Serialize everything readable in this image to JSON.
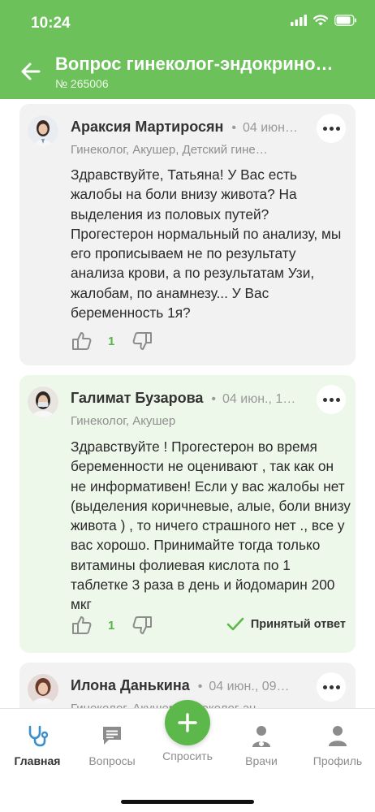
{
  "status_bar": {
    "time": "10:24",
    "signal_icon": "signal-icon",
    "wifi_icon": "wifi-icon",
    "battery_icon": "battery-icon"
  },
  "header": {
    "title": "Вопрос гинеколог-эндокрино…",
    "subtitle": "№ 265006",
    "back_icon": "arrow-left-icon",
    "color": "#6cc15a"
  },
  "answers": [
    {
      "name": "Араксия Мартиросян",
      "date": "04 июн…",
      "specialty": "Гинеколог, Акушер, Детский гине…",
      "text": "Здравствуйте, Татьяна!  У Вас есть жалобы на боли внизу живота? На выделения из половых путей? Прогестерон нормальный по анализу, мы его прописываем не по результату анализа крови, а по результатам Узи, жалобам, по анамнезу...  У Вас беременность 1я?",
      "likes": "1",
      "accepted": false
    },
    {
      "name": "Галимат Бузарова",
      "date": "04 июн., 1…",
      "specialty": "Гинеколог, Акушер",
      "text": "Здравствуйте ! Прогестерон во время беременности не оценивают , так как он не информативен! Если у вас жалобы нет (выделения коричневые, алые, боли внизу живота ) , то ничего страшного нет ., все у вас хорошо. Принимайте тогда только витамины фолиевая кислота по 1 таблетке 3 раза в день и йодомарин 200 мкг",
      "likes": "1",
      "accepted": true,
      "accepted_label": "Принятый ответ"
    },
    {
      "name": "Илона Данькина",
      "date": "04 июн., 09…",
      "specialty": "Гинеколог, Акушер, Гинеколог-эн…",
      "text": "",
      "likes": "",
      "accepted": false
    }
  ],
  "tabbar": {
    "tabs": [
      {
        "label": "Главная",
        "icon": "stethoscope-icon",
        "active": true
      },
      {
        "label": "Вопросы",
        "icon": "chat-icon",
        "active": false
      },
      {
        "label": "Спросить",
        "icon": "plus-icon",
        "active": false
      },
      {
        "label": "Врачи",
        "icon": "doctor-icon",
        "active": false
      },
      {
        "label": "Профиль",
        "icon": "person-icon",
        "active": false
      }
    ]
  },
  "colors": {
    "accent": "#6cc15a",
    "active_tab": "#3d8fc9",
    "accepted_bg": "#eef8ea",
    "card_bg": "#f2f2f2"
  }
}
